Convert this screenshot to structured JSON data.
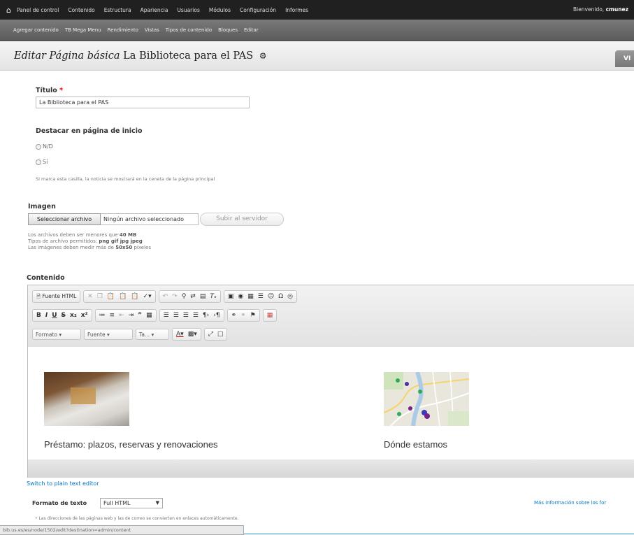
{
  "toolbar": {
    "home_icon": "home-icon",
    "items": [
      "Panel de control",
      "Contenido",
      "Estructura",
      "Apariencia",
      "Usuarios",
      "Módulos",
      "Configuración",
      "Informes"
    ],
    "welcome_prefix": "Bienvenido,",
    "user": "cmunez"
  },
  "shortcuts": {
    "items": [
      "Agregar contenido",
      "TB Mega Menu",
      "Rendimiento",
      "Vistas",
      "Tipos de contenido",
      "Bloques",
      "Editar"
    ]
  },
  "header": {
    "title_italic": "Editar Página básica",
    "title_rest": "La Biblioteca para el PAS",
    "gear_icon": "gear-icon",
    "tab_view": "VI"
  },
  "form": {
    "titulo_label": "Título",
    "required_mark": "*",
    "titulo_value": "La Biblioteca para el PAS",
    "destacar_label": "Destacar en página de inicio",
    "options": [
      "N/D",
      "Sí"
    ],
    "destacar_help": "Si marca esta casilla, la noticia se mostrará en la ceneta de la página principal",
    "imagen_label": "Imagen",
    "file_button": "Seleccionar archivo",
    "file_name": "Ningún archivo seleccionado",
    "upload_button": "Subir al servidor",
    "hints": {
      "line1_prefix": "Los archivos deben ser menores que",
      "line1_value": "40 MB",
      "line2_prefix": "Tipos de archivo permitidos:",
      "line2_value": "png gif jpg jpeg",
      "line3_prefix": "Las imágenes deben medir más de",
      "line3_value": "50x50",
      "line3_suffix": "píxeles"
    },
    "contenido_label": "Contenido"
  },
  "editor": {
    "source_button": "Fuente HTML",
    "row1_icons": [
      "cut-icon",
      "copy-icon",
      "paste-icon",
      "paste-text-icon",
      "paste-word-icon",
      "spellcheck-icon",
      "undo-icon",
      "redo-icon",
      "find-icon",
      "replace-icon",
      "select-all-icon",
      "remove-format-icon",
      "image-icon",
      "flash-icon",
      "table-icon",
      "horizontal-rule-icon",
      "smiley-icon",
      "special-char-icon",
      "iframe-icon"
    ],
    "row2_icons": [
      "bold-icon",
      "italic-icon",
      "underline-icon",
      "strike-icon",
      "subscript-icon",
      "superscript-icon",
      "numbered-list-icon",
      "bulleted-list-icon",
      "outdent-icon",
      "indent-icon",
      "blockquote-icon",
      "div-icon",
      "align-left-icon",
      "align-center-icon",
      "align-right-icon",
      "justify-icon",
      "ltr-icon",
      "rtl-icon",
      "link-icon",
      "unlink-icon",
      "anchor-icon",
      "mega-icon"
    ],
    "combos": [
      "Formato",
      "Fuente",
      "Ta..."
    ],
    "content": {
      "left_caption": "Préstamo: plazos, reservas y renovaciones",
      "right_caption": "Dónde estamos"
    },
    "switch_link": "Switch to plain text editor"
  },
  "format": {
    "label": "Formato de texto",
    "selected": "Full HTML",
    "more_link": "Más información sobre los for",
    "tip": "Las direcciones de las páginas web y las de correo se convierten en enlaces automáticamente."
  },
  "statusbar": {
    "url": "bib.us.es/es/node/1502/edit?destination=admin/content"
  }
}
